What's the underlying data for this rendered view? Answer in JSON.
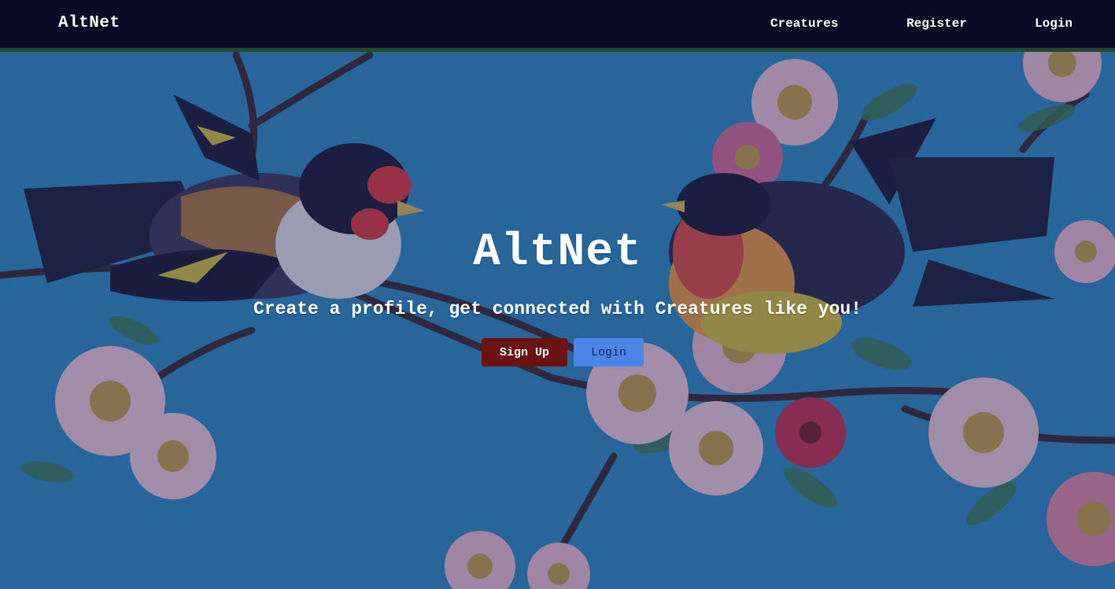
{
  "navbar": {
    "brand": "AltNet",
    "links": {
      "creatures": "Creatures",
      "register": "Register",
      "login": "Login"
    }
  },
  "hero": {
    "title": "AltNet",
    "subtitle": "Create a profile, get connected with Creatures like you!",
    "signup_label": "Sign Up",
    "login_label": "Login"
  },
  "colors": {
    "navbar_bg": "#0b0a24",
    "navbar_border": "#1f4a2c",
    "signup_button": "#6b1212",
    "login_button": "#4a86e8",
    "background_sky": "#2f8fc2"
  },
  "background_image": "birds-and-cherry-blossoms-illustration"
}
